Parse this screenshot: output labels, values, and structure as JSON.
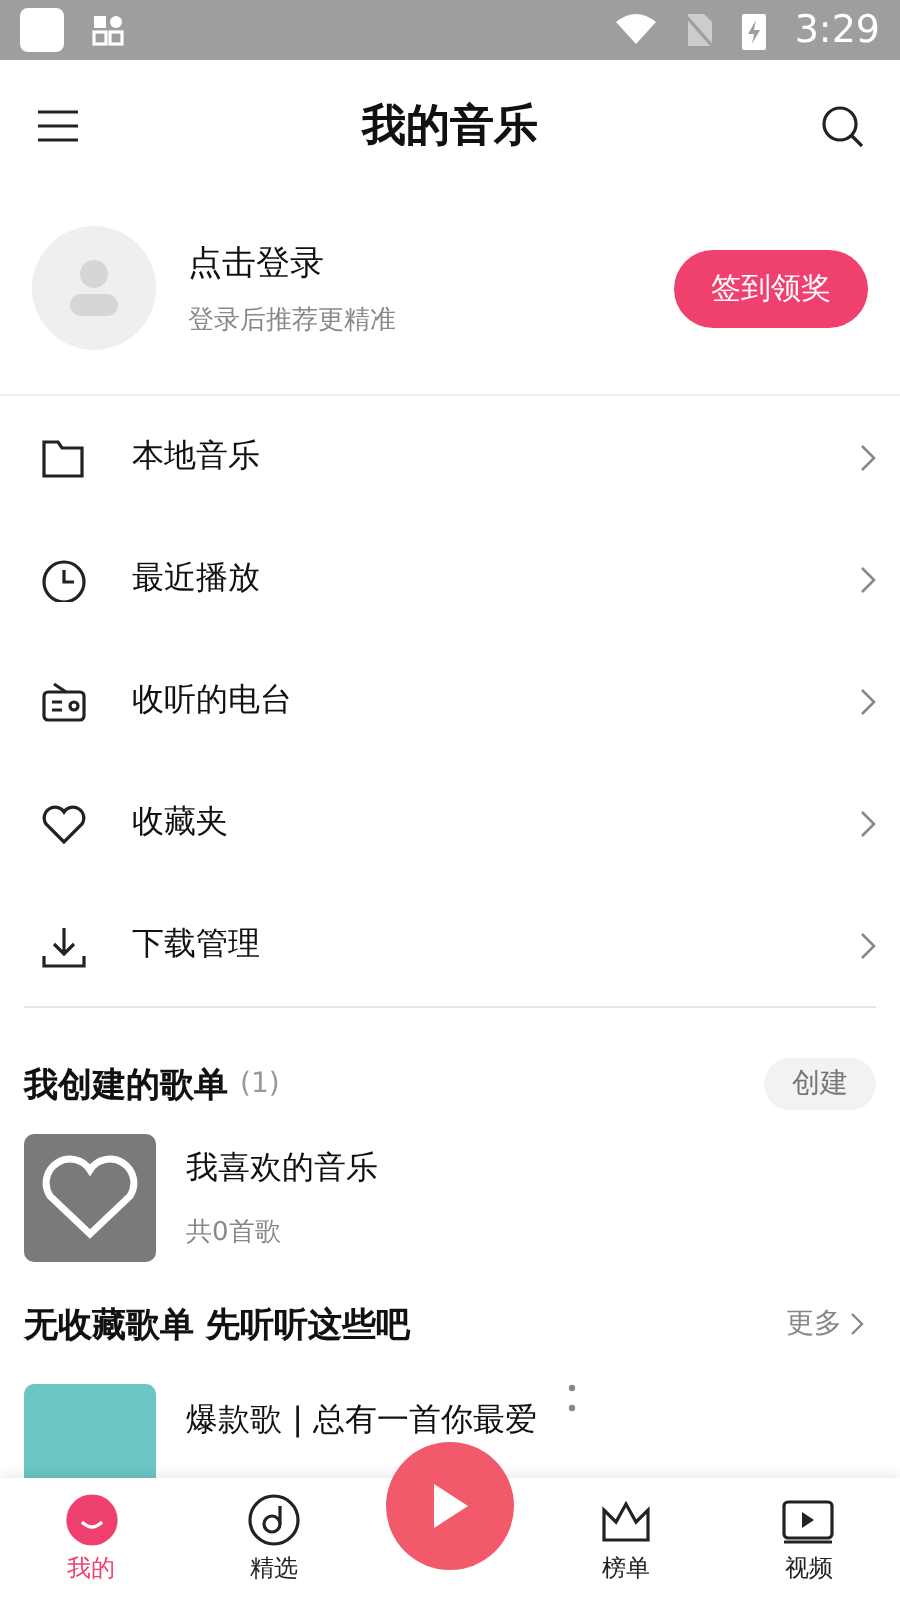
{
  "status_bar": {
    "time": "3:29"
  },
  "header": {
    "title": "我的音乐"
  },
  "profile": {
    "name": "点击登录",
    "hint": "登录后推荐更精准",
    "button": "签到领奖"
  },
  "menu": [
    {
      "kind": "folder",
      "label": "本地音乐"
    },
    {
      "kind": "clock",
      "label": "最近播放"
    },
    {
      "kind": "radio",
      "label": "收听的电台"
    },
    {
      "kind": "heart",
      "label": "收藏夹"
    },
    {
      "kind": "download",
      "label": "下载管理"
    }
  ],
  "created": {
    "title": "我创建的歌单",
    "count": "(1)",
    "button": "创建",
    "playlists": [
      {
        "name": "我喜欢的音乐",
        "info": "共0首歌"
      }
    ]
  },
  "suggest": {
    "title": "无收藏歌单 先听听这些吧",
    "more": "更多",
    "playlists": [
      {
        "name": "爆款歌 | 总有一首你最爱"
      }
    ]
  },
  "nav": [
    {
      "kind": "mine",
      "label": "我的",
      "selected": true
    },
    {
      "kind": "disc",
      "label": "精选",
      "selected": false
    },
    {
      "kind": "play",
      "selected": false
    },
    {
      "kind": "chart",
      "label": "榜单",
      "selected": false
    },
    {
      "kind": "video",
      "label": "视频",
      "selected": false
    }
  ]
}
